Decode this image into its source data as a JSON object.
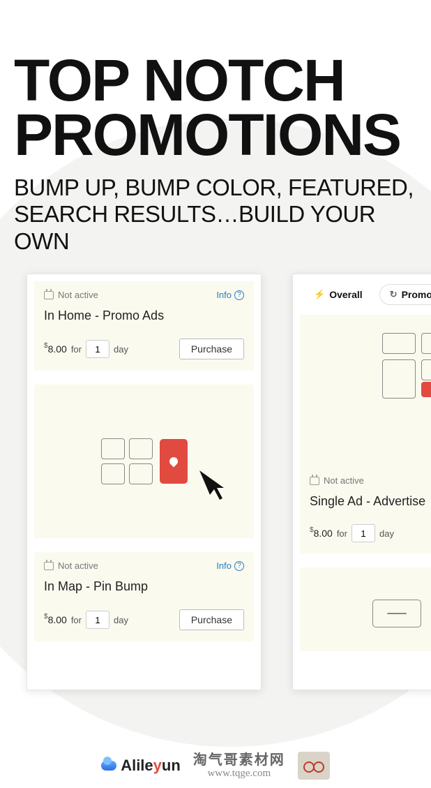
{
  "heading": {
    "line1": "TOP NOTCH",
    "line2": "PROMOTIONS"
  },
  "subhead": "BUMP UP, BUMP COLOR, FEATURED, SEARCH RESULTS…BUILD YOUR OWN",
  "left_card": {
    "item1": {
      "status": "Not active",
      "info": "Info",
      "title": "In Home - Promo Ads",
      "currency": "$",
      "price": "8.00",
      "for": "for",
      "days": "1",
      "unit": "day",
      "cta": "Purchase"
    },
    "item2": {
      "status": "Not active",
      "info": "Info",
      "title": "In Map - Pin Bump",
      "currency": "$",
      "price": "8.00",
      "for": "for",
      "days": "1",
      "unit": "day",
      "cta": "Purchase"
    }
  },
  "right_card": {
    "tab1": "Overall",
    "tab2": "Promotion",
    "item": {
      "status": "Not active",
      "title": "Single Ad - Advertise",
      "currency": "$",
      "price": "8.00",
      "for": "for",
      "days": "1",
      "unit": "day"
    }
  },
  "footer": {
    "brand_pre": "Alile",
    "brand_y": "y",
    "brand_post": "un",
    "wm_cn": "淘气哥素材网",
    "wm_url": "www.tqge.com"
  }
}
